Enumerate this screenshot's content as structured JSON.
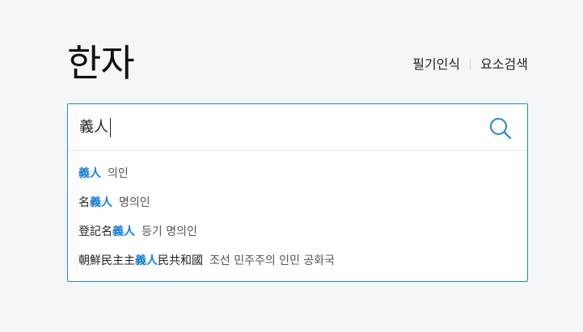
{
  "header": {
    "title": "한자",
    "links": [
      {
        "label": "필기인식"
      },
      {
        "label": "요소검색"
      }
    ]
  },
  "search": {
    "value": "義人",
    "icon": "search-icon",
    "accent_color": "#1e8bc3"
  },
  "suggestions": [
    {
      "pre": "",
      "match": "義人",
      "post": "",
      "reading": "의인"
    },
    {
      "pre": "名",
      "match": "義人",
      "post": "",
      "reading": "명의인"
    },
    {
      "pre": "登記名",
      "match": "義人",
      "post": "",
      "reading": "등기 명의인"
    },
    {
      "pre": "朝鮮民主主",
      "match": "義人",
      "post": "民共和國",
      "reading": "조선 민주주의 인민 공화국"
    }
  ],
  "highlight_color": "#1a7fd4"
}
